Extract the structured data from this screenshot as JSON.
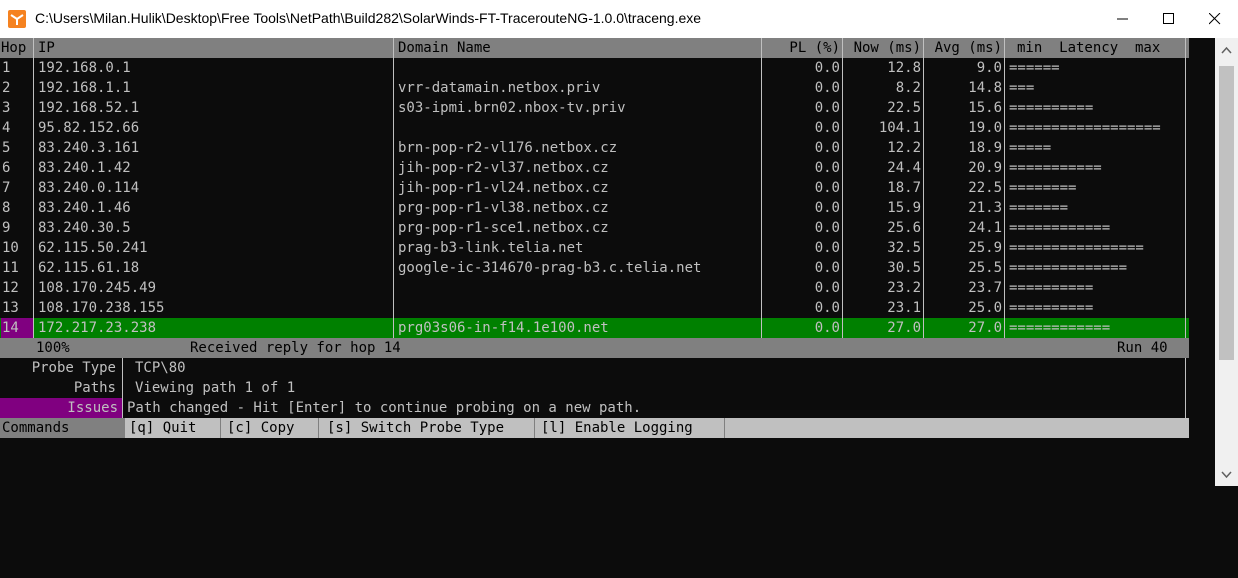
{
  "window": {
    "title": "C:\\Users\\Milan.Hulik\\Desktop\\Free Tools\\NetPath\\Build282\\SolarWinds-FT-TracerouteNG-1.0.0\\traceng.exe"
  },
  "table": {
    "headers": {
      "hop": "Hop",
      "ip": "IP",
      "domain": "Domain Name",
      "pl": "PL (%)",
      "now": "Now (ms)",
      "avg": "Avg (ms)",
      "latency": "min  Latency  max"
    },
    "rows": [
      {
        "hop": "1",
        "ip": "192.168.0.1",
        "domain": "",
        "pl": "0.0",
        "now": "12.8",
        "avg": "9.0",
        "bar": "======"
      },
      {
        "hop": "2",
        "ip": "192.168.1.1",
        "domain": "vrr-datamain.netbox.priv",
        "pl": "0.0",
        "now": "8.2",
        "avg": "14.8",
        "bar": "==="
      },
      {
        "hop": "3",
        "ip": "192.168.52.1",
        "domain": "s03-ipmi.brn02.nbox-tv.priv",
        "pl": "0.0",
        "now": "22.5",
        "avg": "15.6",
        "bar": "=========="
      },
      {
        "hop": "4",
        "ip": "95.82.152.66",
        "domain": "",
        "pl": "0.0",
        "now": "104.1",
        "avg": "19.0",
        "bar": "=================="
      },
      {
        "hop": "5",
        "ip": "83.240.3.161",
        "domain": "brn-pop-r2-vl176.netbox.cz",
        "pl": "0.0",
        "now": "12.2",
        "avg": "18.9",
        "bar": "====="
      },
      {
        "hop": "6",
        "ip": "83.240.1.42",
        "domain": "jih-pop-r2-vl37.netbox.cz",
        "pl": "0.0",
        "now": "24.4",
        "avg": "20.9",
        "bar": "==========="
      },
      {
        "hop": "7",
        "ip": "83.240.0.114",
        "domain": "jih-pop-r1-vl24.netbox.cz",
        "pl": "0.0",
        "now": "18.7",
        "avg": "22.5",
        "bar": "========"
      },
      {
        "hop": "8",
        "ip": "83.240.1.46",
        "domain": "prg-pop-r1-vl38.netbox.cz",
        "pl": "0.0",
        "now": "15.9",
        "avg": "21.3",
        "bar": "======="
      },
      {
        "hop": "9",
        "ip": "83.240.30.5",
        "domain": "prg-pop-r1-sce1.netbox.cz",
        "pl": "0.0",
        "now": "25.6",
        "avg": "24.1",
        "bar": "============"
      },
      {
        "hop": "10",
        "ip": "62.115.50.241",
        "domain": "prag-b3-link.telia.net",
        "pl": "0.0",
        "now": "32.5",
        "avg": "25.9",
        "bar": "================"
      },
      {
        "hop": "11",
        "ip": "62.115.61.18",
        "domain": "google-ic-314670-prag-b3.c.telia.net",
        "pl": "0.0",
        "now": "30.5",
        "avg": "25.5",
        "bar": "=============="
      },
      {
        "hop": "12",
        "ip": "108.170.245.49",
        "domain": "",
        "pl": "0.0",
        "now": "23.2",
        "avg": "23.7",
        "bar": "=========="
      },
      {
        "hop": "13",
        "ip": "108.170.238.155",
        "domain": "",
        "pl": "0.0",
        "now": "23.1",
        "avg": "25.0",
        "bar": "=========="
      },
      {
        "hop": "14",
        "ip": "172.217.23.238",
        "domain": "prg03s06-in-f14.1e100.net",
        "pl": "0.0",
        "now": "27.0",
        "avg": "27.0",
        "bar": "============"
      }
    ]
  },
  "status": {
    "percent": "100%",
    "message": "Received reply for hop 14",
    "run": "Run 40"
  },
  "info": {
    "probe_type_label": "Probe Type",
    "probe_type_value": "TCP\\80",
    "paths_label": "Paths",
    "paths_value": "Viewing path 1 of 1",
    "issues_label": "Issues",
    "issues_value": "Path changed - Hit [Enter] to continue probing on a new path."
  },
  "commands": {
    "label": "Commands",
    "quit": "[q] Quit",
    "copy": "[c] Copy",
    "switch": "[s] Switch Probe Type",
    "logging": "[l] Enable Logging"
  },
  "colors": {
    "selected_row": "#008000",
    "selected_hop": "#800080",
    "header_bg": "#808080",
    "command_bg": "#c0c0c0"
  }
}
